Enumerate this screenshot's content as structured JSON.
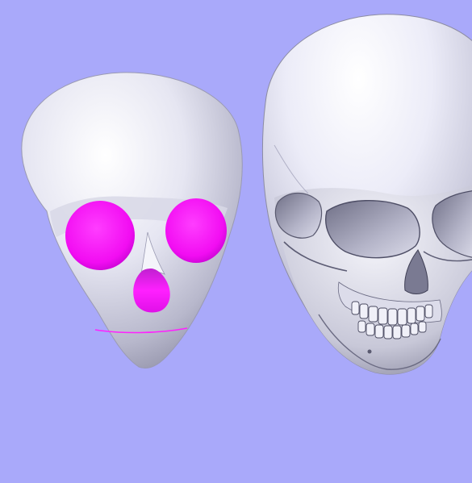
{
  "viewport": {
    "background_color": "#a9a9fa",
    "model_color": "#e9e9f7",
    "highlight_color": "#ff10ff"
  },
  "scene": {
    "objects": [
      {
        "name": "stylized-head",
        "parts": [
          "head-shell",
          "eye-socket-left",
          "eye-socket-right",
          "nose-cavity",
          "chin-seam"
        ]
      },
      {
        "name": "human-skull",
        "parts": [
          "cranium",
          "orbit-left",
          "orbit-right",
          "nasal-cavity",
          "teeth",
          "jaw"
        ]
      }
    ]
  }
}
